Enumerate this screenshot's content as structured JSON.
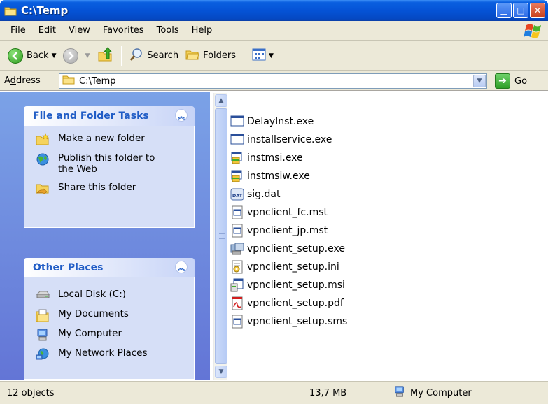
{
  "window": {
    "title": "C:\\Temp"
  },
  "menu": {
    "items": [
      {
        "label": "File",
        "accel": "F",
        "rest": "ile"
      },
      {
        "label": "Edit",
        "accel": "E",
        "rest": "dit"
      },
      {
        "label": "View",
        "accel": "V",
        "rest": "iew"
      },
      {
        "label": "Favorites",
        "pre": "F",
        "accel": "a",
        "rest": "vorites"
      },
      {
        "label": "Tools",
        "accel": "T",
        "rest": "ools"
      },
      {
        "label": "Help",
        "accel": "H",
        "rest": "elp"
      }
    ]
  },
  "toolbar": {
    "back": "Back",
    "search": "Search",
    "folders": "Folders"
  },
  "address": {
    "label_pre": "A",
    "label_accel": "d",
    "label_rest": "dress",
    "value": "C:\\Temp",
    "go": "Go"
  },
  "tasks": {
    "header": "File and Folder Tasks",
    "items": [
      "Make a new folder",
      "Publish this folder to the Web",
      "Share this folder"
    ]
  },
  "places": {
    "header": "Other Places",
    "items": [
      "Local Disk (C:)",
      "My Documents",
      "My Computer",
      "My Network Places"
    ]
  },
  "files": [
    {
      "name": "DelayInst.exe",
      "icon": "exe-window-icon"
    },
    {
      "name": "installservice.exe",
      "icon": "exe-window-icon"
    },
    {
      "name": "instmsi.exe",
      "icon": "installer-icon"
    },
    {
      "name": "instmsiw.exe",
      "icon": "installer-icon"
    },
    {
      "name": "sig.dat",
      "icon": "dat-file-icon"
    },
    {
      "name": "vpnclient_fc.mst",
      "icon": "mst-file-icon"
    },
    {
      "name": "vpnclient_jp.mst",
      "icon": "mst-file-icon"
    },
    {
      "name": "vpnclient_setup.exe",
      "icon": "setup-exe-icon"
    },
    {
      "name": "vpnclient_setup.ini",
      "icon": "ini-file-icon"
    },
    {
      "name": "vpnclient_setup.msi",
      "icon": "msi-file-icon"
    },
    {
      "name": "vpnclient_setup.pdf",
      "icon": "pdf-file-icon"
    },
    {
      "name": "vpnclient_setup.sms",
      "icon": "sms-file-icon"
    }
  ],
  "status": {
    "count": "12 objects",
    "size": "13,7 MB",
    "location": "My Computer"
  },
  "colors": {
    "titlebar": "#0553d6",
    "taskpane": "#6f8de0",
    "pane_header_text": "#215dc6"
  }
}
